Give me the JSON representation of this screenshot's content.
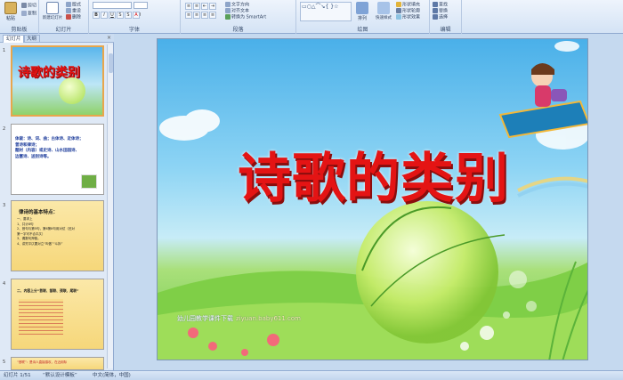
{
  "ribbon": {
    "groups": {
      "clipboard": "剪贴板",
      "slides": "幻灯片",
      "font": "字体",
      "paragraph": "段落",
      "drawing": "绘图",
      "editing": "编辑"
    },
    "paste": "粘贴",
    "cut": "剪切",
    "copy": "复制",
    "new_slide": "新建幻灯片",
    "layout": "版式",
    "reset": "重设",
    "delete": "删除",
    "font_size": "20",
    "text_direction": "文字方向",
    "align_text": "对齐文本",
    "smartart": "转换为 SmartArt",
    "arrange": "排列",
    "quick_styles": "快速样式",
    "shape_fill": "形状填充",
    "shape_outline": "形状轮廓",
    "shape_effects": "形状效果",
    "find": "查找",
    "replace": "替换",
    "select": "选择"
  },
  "panel": {
    "tab_slides": "幻灯片",
    "tab_outline": "大纲",
    "close": "×",
    "thumbs": [
      {
        "num": "1",
        "title": "诗歌的类别"
      },
      {
        "num": "2",
        "lines": [
          "体裁：诗、词、曲；古体诗、近体诗；",
          "曾诗和律诗；",
          "题材（内容）或史诗、山水田园诗、",
          "边塞诗、送别诗等。"
        ]
      },
      {
        "num": "3",
        "title": "律诗的基本特点：",
        "lines": [
          "一、要求上",
          "1、共计8句",
          "2、首句与第5句，第6第8句用对仗（还对",
          "第一字可不合平仄）",
          "3、偶数句押韵。",
          "4、讲究平仄要对立“叫做”“斗拆”"
        ]
      },
      {
        "num": "4",
        "title": "二、内容上分“首联、颔联、颈联、尾联”"
      },
      {
        "num": "5",
        "lines": [
          "“首联”：是诗人直接感叹，在近用际",
          "的组对之法，称为。"
        ]
      }
    ]
  },
  "slide": {
    "title": "诗歌的类别",
    "footer_text": "幼儿园教学课件下载",
    "footer_url": "ziyuan.baby611.com"
  },
  "status": {
    "slide_info": "幻灯片 1/51",
    "theme": "“默认设计模板”",
    "language": "中文(简体，中国)"
  },
  "colors": {
    "title_red": "#e41414",
    "selected_border": "#e8a64c",
    "ribbon_bg": "#d4e3f5"
  }
}
